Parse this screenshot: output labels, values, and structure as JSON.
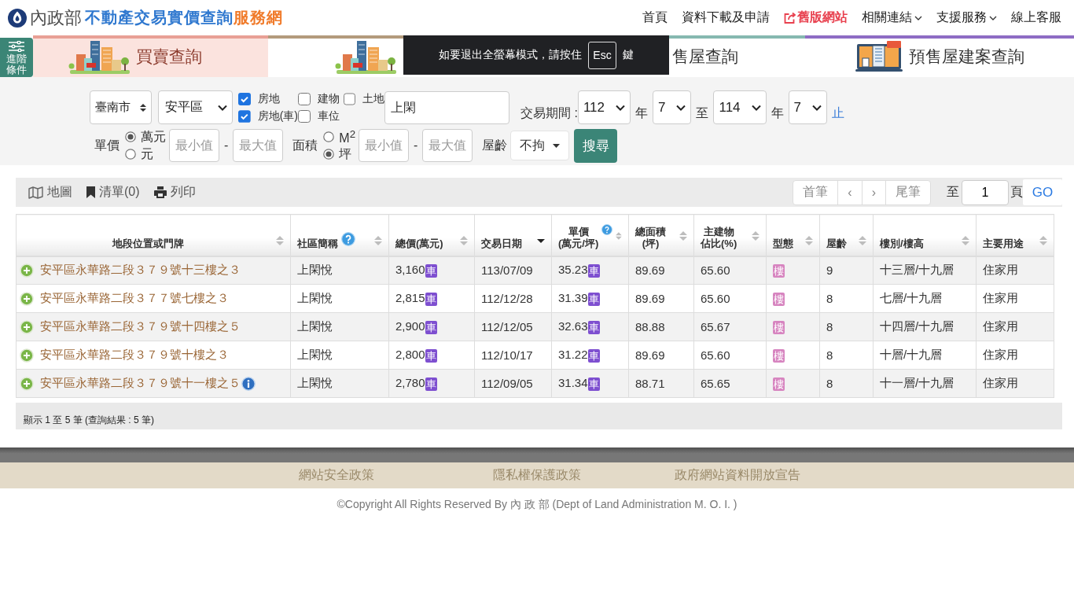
{
  "header": {
    "ministry": "內政部",
    "title": "不動產交易實價查詢",
    "title_suffix": "服務網",
    "nav": [
      {
        "label": "首頁",
        "kind": "link"
      },
      {
        "label": "資料下載及申請",
        "kind": "link"
      },
      {
        "label": "舊版網站",
        "kind": "external"
      },
      {
        "label": "相關連結",
        "kind": "dropdown"
      },
      {
        "label": "支援服務",
        "kind": "dropdown"
      },
      {
        "label": "線上客服",
        "kind": "link"
      }
    ]
  },
  "advanced_button": {
    "label": "進階條件"
  },
  "tabs": [
    {
      "label": "買賣查詢",
      "selected": true,
      "color": "#e8a095"
    },
    {
      "selected": false,
      "color": "#b39b7c"
    },
    {
      "label": "售屋查詢",
      "selected": false,
      "color": "#86b8b0"
    },
    {
      "label": "預售屋建案查詢",
      "selected": false,
      "color": "#8e6cc4"
    }
  ],
  "fullscreen_notice": {
    "before": "如要退出全螢幕模式，請按住",
    "key": "Esc",
    "after": "鍵"
  },
  "filters": {
    "city": "臺南市",
    "district": "安平區",
    "property_types": [
      {
        "label": "房地",
        "checked": true
      },
      {
        "label": "建物",
        "checked": false
      },
      {
        "label": "土地",
        "checked": false
      },
      {
        "label": "房地(車)",
        "checked": true
      },
      {
        "label": "車位",
        "checked": false
      }
    ],
    "keyword": "上閑",
    "period": {
      "label": "交易期間 :",
      "parts": [
        {
          "kind": "select",
          "value": "112"
        },
        {
          "kind": "text",
          "value": "年"
        },
        {
          "kind": "select",
          "value": "7"
        },
        {
          "kind": "text",
          "value": "至"
        },
        {
          "kind": "select",
          "value": "114"
        },
        {
          "kind": "text",
          "value": "年"
        },
        {
          "kind": "select",
          "value": "7"
        },
        {
          "kind": "end",
          "value": "止"
        }
      ]
    },
    "unit_price": {
      "label": "單價",
      "units": [
        {
          "label": "萬元",
          "selected": true
        },
        {
          "label": "元",
          "selected": false
        }
      ],
      "min": {
        "placeholder": "最小值"
      },
      "separator": "-",
      "max": {
        "placeholder": "最大值"
      }
    },
    "area": {
      "label": "面積",
      "units": [
        {
          "label": "M$^{2}$",
          "selected": false
        },
        {
          "label": "坪",
          "selected": true
        }
      ],
      "min": {
        "placeholder": "最小值"
      },
      "separator": "-",
      "max": {
        "placeholder": "最大值"
      }
    },
    "age": {
      "label": "屋齡",
      "value": "不拘"
    },
    "search_button": "搜尋"
  },
  "results": {
    "toolbar": [
      {
        "label": "地圖"
      },
      {
        "label": "清單(0)"
      },
      {
        "label": "列印"
      }
    ],
    "pager": {
      "buttons": [
        {
          "label": "首筆"
        },
        {
          "label": "‹"
        },
        {
          "label": "›"
        },
        {
          "label": "尾筆"
        }
      ],
      "goto_label": "至",
      "page": "1",
      "page_unit": "頁",
      "go": "GO"
    },
    "table": {
      "columns": [
        {
          "lines": [
            "地段位置或門牌"
          ],
          "help": false,
          "sorted": false
        },
        {
          "lines": [
            "社區簡稱"
          ],
          "help": true,
          "sorted": false
        },
        {
          "lines": [
            "總價(萬元)"
          ],
          "help": false,
          "sorted": false
        },
        {
          "lines": [
            "交易日期"
          ],
          "help": false,
          "sorted": true
        },
        {
          "lines": [
            "單價",
            "(萬元/坪)"
          ],
          "help": true,
          "sorted": false
        },
        {
          "lines": [
            "總面積",
            "(坪)"
          ],
          "help": false,
          "sorted": false
        },
        {
          "lines": [
            "主建物",
            "佔比(%)"
          ],
          "help": false,
          "sorted": false
        },
        {
          "lines": [
            "型態"
          ],
          "help": false,
          "sorted": false
        },
        {
          "lines": [
            "屋齡"
          ],
          "help": false,
          "sorted": false
        },
        {
          "lines": [
            "樓別/樓高"
          ],
          "help": false,
          "sorted": false
        },
        {
          "lines": [
            "主要用途"
          ],
          "help": false,
          "sorted": false
        }
      ],
      "rows": [
        {
          "address": "安平區永華路二段３７９號十三樓之３",
          "info": false,
          "community": "上閑悅",
          "total_price": "3,160",
          "price_tag": "車",
          "date": "113/07/09",
          "unit_price": "35.23",
          "unit_price_tag": "車",
          "area": "89.69",
          "ratio": "65.60",
          "type": "樓",
          "age": "9",
          "floor": "十三層/十九層",
          "use": "住家用"
        },
        {
          "address": "安平區永華路二段３７７號七樓之３",
          "info": false,
          "community": "上閑悅",
          "total_price": "2,815",
          "price_tag": "車",
          "date": "112/12/28",
          "unit_price": "31.39",
          "unit_price_tag": "車",
          "area": "89.69",
          "ratio": "65.60",
          "type": "樓",
          "age": "8",
          "floor": "七層/十九層",
          "use": "住家用"
        },
        {
          "address": "安平區永華路二段３７９號十四樓之５",
          "info": false,
          "community": "上閑悅",
          "total_price": "2,900",
          "price_tag": "車",
          "date": "112/12/05",
          "unit_price": "32.63",
          "unit_price_tag": "車",
          "area": "88.88",
          "ratio": "65.67",
          "type": "樓",
          "age": "8",
          "floor": "十四層/十九層",
          "use": "住家用"
        },
        {
          "address": "安平區永華路二段３７９號十樓之３",
          "info": false,
          "community": "上閑悅",
          "total_price": "2,800",
          "price_tag": "車",
          "date": "112/10/17",
          "unit_price": "31.22",
          "unit_price_tag": "車",
          "area": "89.69",
          "ratio": "65.60",
          "type": "樓",
          "age": "8",
          "floor": "十層/十九層",
          "use": "住家用"
        },
        {
          "address": "安平區永華路二段３７９號十一樓之５",
          "info": true,
          "community": "上閑悅",
          "total_price": "2,780",
          "price_tag": "車",
          "date": "112/09/05",
          "unit_price": "31.34",
          "unit_price_tag": "車",
          "area": "88.71",
          "ratio": "65.65",
          "type": "樓",
          "age": "8",
          "floor": "十一層/十九層",
          "use": "住家用"
        }
      ]
    },
    "summary": "顯示 1 至 5 筆 (查詢結果 : 5 筆)"
  },
  "footer": {
    "links": [
      "網站安全政策",
      "隱私權保護政策",
      "政府網站資料開放宣告"
    ],
    "copyright": "©Copyright All Rights Reserved By 內 政 部 (Dept of Land Administration M. O. I. )"
  }
}
